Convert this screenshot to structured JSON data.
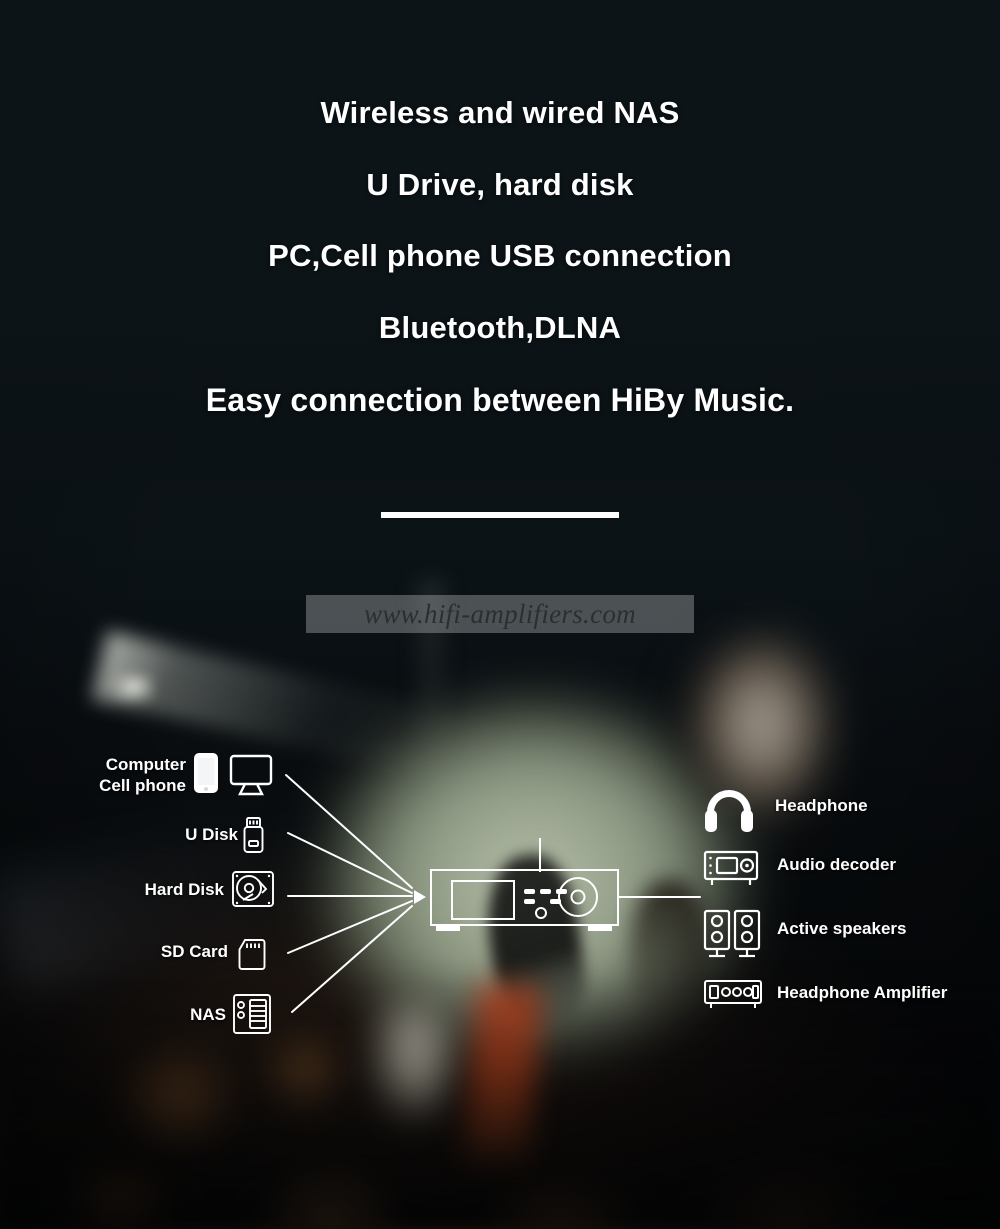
{
  "headline": {
    "lines": [
      "Wireless and wired NAS",
      "U Drive, hard disk",
      "PC,Cell phone USB connection",
      "Bluetooth,DLNA",
      "Easy connection between HiBy Music."
    ]
  },
  "divider": {
    "present": true
  },
  "watermark": {
    "text": "www.hifi-amplifiers.com"
  },
  "diagram": {
    "sources": [
      {
        "label": "Computer\nCell phone",
        "label_line1": "Computer",
        "label_line2": "Cell phone",
        "icons": [
          "cell-phone-icon",
          "computer-monitor-icon"
        ]
      },
      {
        "label": "U Disk",
        "icons": [
          "usb-flash-drive-icon"
        ]
      },
      {
        "label": "Hard Disk",
        "icons": [
          "hard-disk-icon"
        ]
      },
      {
        "label": "SD Card",
        "icons": [
          "sd-card-icon"
        ]
      },
      {
        "label": "NAS",
        "icons": [
          "nas-server-icon"
        ]
      }
    ],
    "device": {
      "name": "hifi-player-device",
      "icon": "hifi-player-icon"
    },
    "outputs": [
      {
        "label": "Headphone",
        "icon": "headphone-icon"
      },
      {
        "label": "Audio decoder",
        "icon": "audio-decoder-icon"
      },
      {
        "label": "Active speakers",
        "icon": "active-speakers-icon"
      },
      {
        "label": "Headphone Amplifier",
        "icon": "headphone-amplifier-icon"
      }
    ]
  },
  "colors": {
    "background_top": "#0c1418",
    "text": "#ffffff",
    "line": "#ffffff",
    "watermark_text": "#2b2f30",
    "watermark_band": "rgba(168,172,172,0.42)"
  }
}
